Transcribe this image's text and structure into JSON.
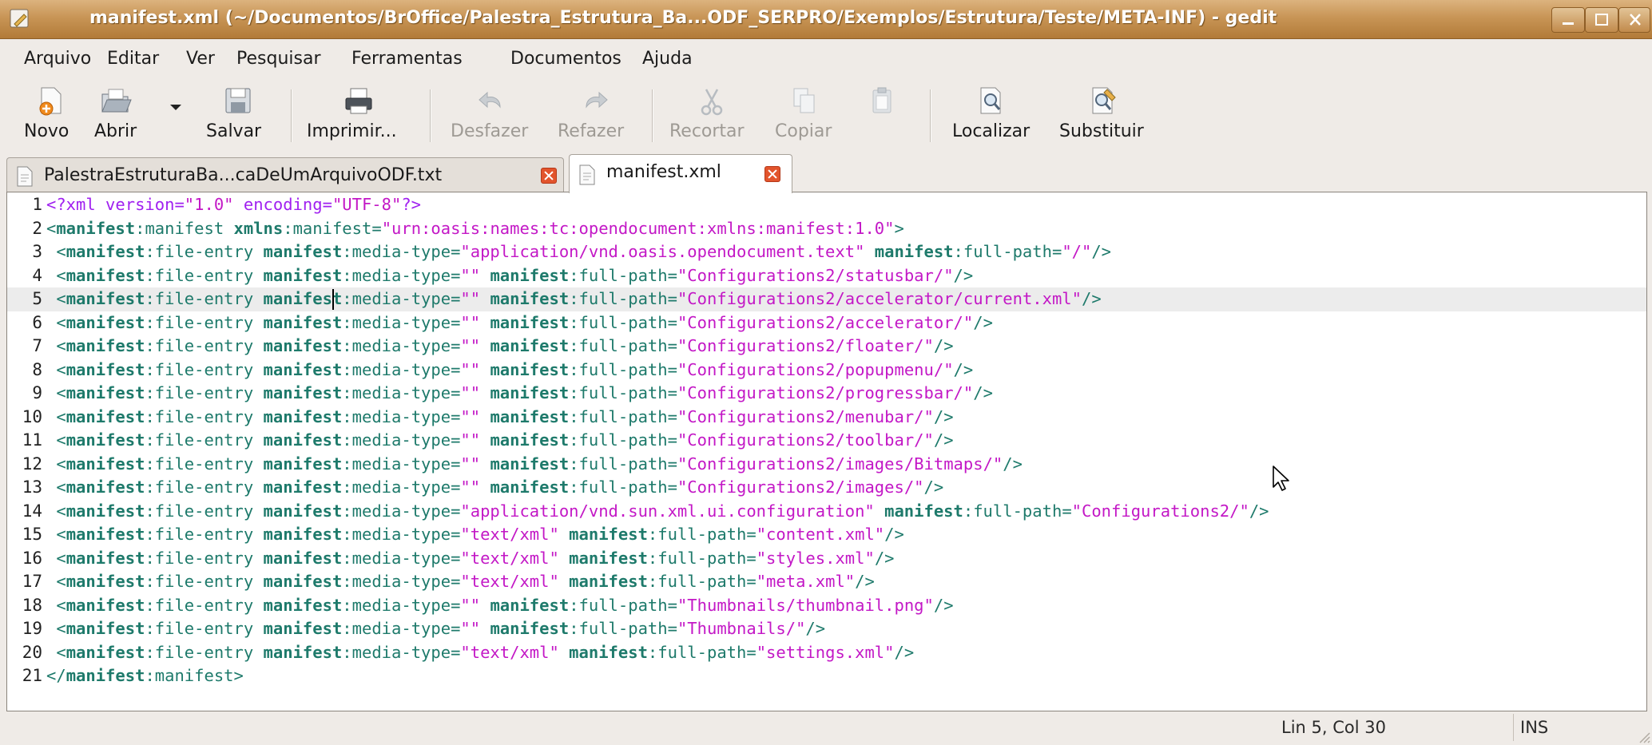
{
  "window": {
    "title": "manifest.xml (~/Documentos/BrOffice/Palestra_Estrutura_Ba...ODF_SERPRO/Exemplos/Estrutura/Teste/META-INF) - gedit"
  },
  "menu": [
    {
      "label": "Arquivo"
    },
    {
      "label": "Editar"
    },
    {
      "label": "Ver"
    },
    {
      "label": "Pesquisar"
    },
    {
      "label": "Ferramentas"
    },
    {
      "label": "Documentos"
    },
    {
      "label": "Ajuda"
    }
  ],
  "toolbar": {
    "new": "Novo",
    "open": "Abrir",
    "save": "Salvar",
    "print": "Imprimir...",
    "undo": "Desfazer",
    "redo": "Refazer",
    "cut": "Recortar",
    "copy": "Copiar",
    "paste": "Colar",
    "find": "Localizar",
    "replace": "Substituir"
  },
  "tabs": [
    {
      "label": "PalestraEstruturaBa...caDeUmArquivoODF.txt",
      "active": false
    },
    {
      "label": "manifest.xml",
      "active": true
    }
  ],
  "editor": {
    "current_line": 5,
    "lines": [
      "<?xml version=\"1.0\" encoding=\"UTF-8\"?>",
      "<manifest:manifest xmlns:manifest=\"urn:oasis:names:tc:opendocument:xmlns:manifest:1.0\">",
      " <manifest:file-entry manifest:media-type=\"application/vnd.oasis.opendocument.text\" manifest:full-path=\"/\"/>",
      " <manifest:file-entry manifest:media-type=\"\" manifest:full-path=\"Configurations2/statusbar/\"/>",
      " <manifest:file-entry manifest:media-type=\"\" manifest:full-path=\"Configurations2/accelerator/current.xml\"/>",
      " <manifest:file-entry manifest:media-type=\"\" manifest:full-path=\"Configurations2/accelerator/\"/>",
      " <manifest:file-entry manifest:media-type=\"\" manifest:full-path=\"Configurations2/floater/\"/>",
      " <manifest:file-entry manifest:media-type=\"\" manifest:full-path=\"Configurations2/popupmenu/\"/>",
      " <manifest:file-entry manifest:media-type=\"\" manifest:full-path=\"Configurations2/progressbar/\"/>",
      " <manifest:file-entry manifest:media-type=\"\" manifest:full-path=\"Configurations2/menubar/\"/>",
      " <manifest:file-entry manifest:media-type=\"\" manifest:full-path=\"Configurations2/toolbar/\"/>",
      " <manifest:file-entry manifest:media-type=\"\" manifest:full-path=\"Configurations2/images/Bitmaps/\"/>",
      " <manifest:file-entry manifest:media-type=\"\" manifest:full-path=\"Configurations2/images/\"/>",
      " <manifest:file-entry manifest:media-type=\"application/vnd.sun.xml.ui.configuration\" manifest:full-path=\"Configurations2/\"/>",
      " <manifest:file-entry manifest:media-type=\"text/xml\" manifest:full-path=\"content.xml\"/>",
      " <manifest:file-entry manifest:media-type=\"text/xml\" manifest:full-path=\"styles.xml\"/>",
      " <manifest:file-entry manifest:media-type=\"text/xml\" manifest:full-path=\"meta.xml\"/>",
      " <manifest:file-entry manifest:media-type=\"\" manifest:full-path=\"Thumbnails/thumbnail.png\"/>",
      " <manifest:file-entry manifest:media-type=\"\" manifest:full-path=\"Thumbnails/\"/>",
      " <manifest:file-entry manifest:media-type=\"text/xml\" manifest:full-path=\"settings.xml\"/>",
      "</manifest:manifest>"
    ]
  },
  "status": {
    "position": "Lin 5, Col 30",
    "mode": "INS"
  },
  "colors": {
    "titlebar": "#c89556",
    "xml_tag": "#1e7a6b",
    "xml_string": "#c318c6",
    "xml_pi": "#a020f0"
  }
}
